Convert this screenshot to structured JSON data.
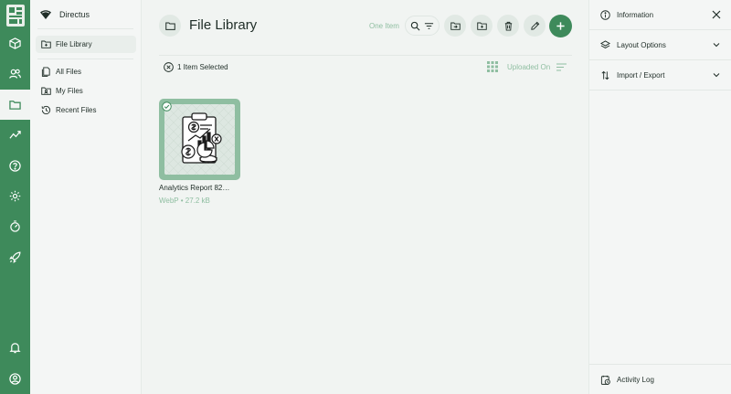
{
  "project": {
    "name": "Directus"
  },
  "module_bar": {
    "modules": [
      {
        "icon": "box-icon",
        "active": false
      },
      {
        "icon": "users-icon",
        "active": false
      },
      {
        "icon": "folder-icon",
        "active": true
      },
      {
        "icon": "insights-icon",
        "active": false
      },
      {
        "icon": "help-icon",
        "active": false
      },
      {
        "icon": "settings-icon",
        "active": false
      },
      {
        "icon": "flows-icon",
        "active": false
      },
      {
        "icon": "rocket-icon",
        "active": false
      }
    ],
    "bottom": [
      {
        "icon": "bell-icon"
      },
      {
        "icon": "user-circle-icon"
      }
    ]
  },
  "nav": {
    "primary": {
      "label": "File Library",
      "icon": "folder-plus-icon"
    },
    "items": [
      {
        "label": "All Files",
        "icon": "files-icon"
      },
      {
        "label": "My Files",
        "icon": "folder-user-icon"
      },
      {
        "label": "Recent Files",
        "icon": "history-icon"
      }
    ]
  },
  "header": {
    "title": "File Library",
    "count": "One Item"
  },
  "selection": {
    "text": "1 Item Selected",
    "sort_label": "Uploaded On"
  },
  "files": [
    {
      "name": "Analytics Report 82…",
      "meta": "WebP • 27.2 kB",
      "selected": true
    }
  ],
  "sidebar": {
    "sections": [
      {
        "label": "Information",
        "icon": "info-icon"
      },
      {
        "label": "Layout Options",
        "icon": "layers-icon"
      },
      {
        "label": "Import / Export",
        "icon": "import-export-icon"
      }
    ],
    "footer": {
      "label": "Activity Log",
      "icon": "activity-log-icon"
    }
  },
  "colors": {
    "primary": "#3e8a5b",
    "primary_light": "#8fbea1",
    "background": "#f1f4f2"
  }
}
